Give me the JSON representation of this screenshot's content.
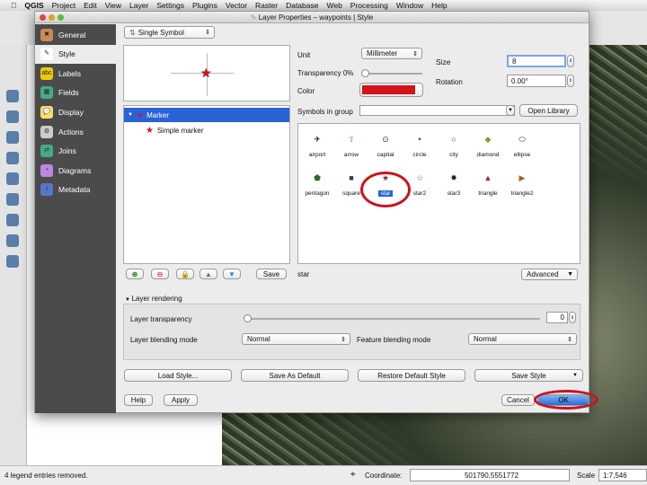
{
  "menubar": {
    "apple": "",
    "app": "QGIS",
    "items": [
      "Project",
      "Edit",
      "View",
      "Layer",
      "Settings",
      "Plugins",
      "Vector",
      "Raster",
      "Database",
      "Web",
      "Processing",
      "Window",
      "Help"
    ]
  },
  "dialog": {
    "title": "Layer Properties – waypoints | Style"
  },
  "sidebar": {
    "items": [
      {
        "label": "General",
        "icon": "wrench-icon"
      },
      {
        "label": "Style",
        "icon": "paintbrush-icon"
      },
      {
        "label": "Labels",
        "icon": "labels-icon"
      },
      {
        "label": "Fields",
        "icon": "table-icon"
      },
      {
        "label": "Display",
        "icon": "speech-bubble-icon"
      },
      {
        "label": "Actions",
        "icon": "gear-icon"
      },
      {
        "label": "Joins",
        "icon": "joins-icon"
      },
      {
        "label": "Diagrams",
        "icon": "diagram-icon"
      },
      {
        "label": "Metadata",
        "icon": "info-icon"
      }
    ],
    "selected": "Style"
  },
  "renderer": "Single Symbol",
  "tree": {
    "items": [
      "Marker",
      "Simple marker"
    ]
  },
  "props": {
    "unit_label": "Unit",
    "unit": "Millimeter",
    "transparency_label": "Transparency 0%",
    "transparency": 0,
    "color_label": "Color",
    "color": "#d4121a",
    "size_label": "Size",
    "size": "8",
    "rotation_label": "Rotation",
    "rotation": "0.00°"
  },
  "symbols": {
    "group_label": "Symbols in group",
    "group_value": "",
    "open_library": "Open Library",
    "items": [
      "airport",
      "arrow",
      "capital",
      "circle",
      "city",
      "diamond",
      "ellipse",
      "pentagon",
      "square",
      "star",
      "star2",
      "star3",
      "triangle",
      "triangle2"
    ],
    "glyphs": [
      "✈",
      "⇧",
      "⊙",
      "•",
      "○",
      "◆",
      "⬭",
      "⬟",
      "■",
      "★",
      "☆",
      "✸",
      "▲",
      "▶"
    ],
    "colors": [
      "#111",
      "#b07a20",
      "#333",
      "#334",
      "#333",
      "#8a9a20",
      "#333",
      "#2a6a2a",
      "#2a3a6a",
      "#7a2a4a",
      "#7a3ac0",
      "#222",
      "#8a2a3a",
      "#b05a20"
    ],
    "selected": "star"
  },
  "under": {
    "save": "Save",
    "name": "star",
    "advanced": "Advanced"
  },
  "rendering": {
    "title": "Layer rendering",
    "transparency_label": "Layer transparency",
    "transparency": "0",
    "blend_label": "Layer blending mode",
    "blend": "Normal",
    "feature_blend_label": "Feature blending mode",
    "feature_blend": "Normal"
  },
  "buttons": {
    "load": "Load Style...",
    "save_default": "Save As Default",
    "restore": "Restore Default Style",
    "save_style": "Save Style",
    "help": "Help",
    "apply": "Apply",
    "cancel": "Cancel",
    "ok": "OK"
  },
  "status": {
    "message": "4 legend entries removed.",
    "coord_label": "Coordinate:",
    "coord": "501790,5551772",
    "scale_label": "Scale",
    "scale": "1:7,546"
  },
  "accent": "#2a62d6"
}
